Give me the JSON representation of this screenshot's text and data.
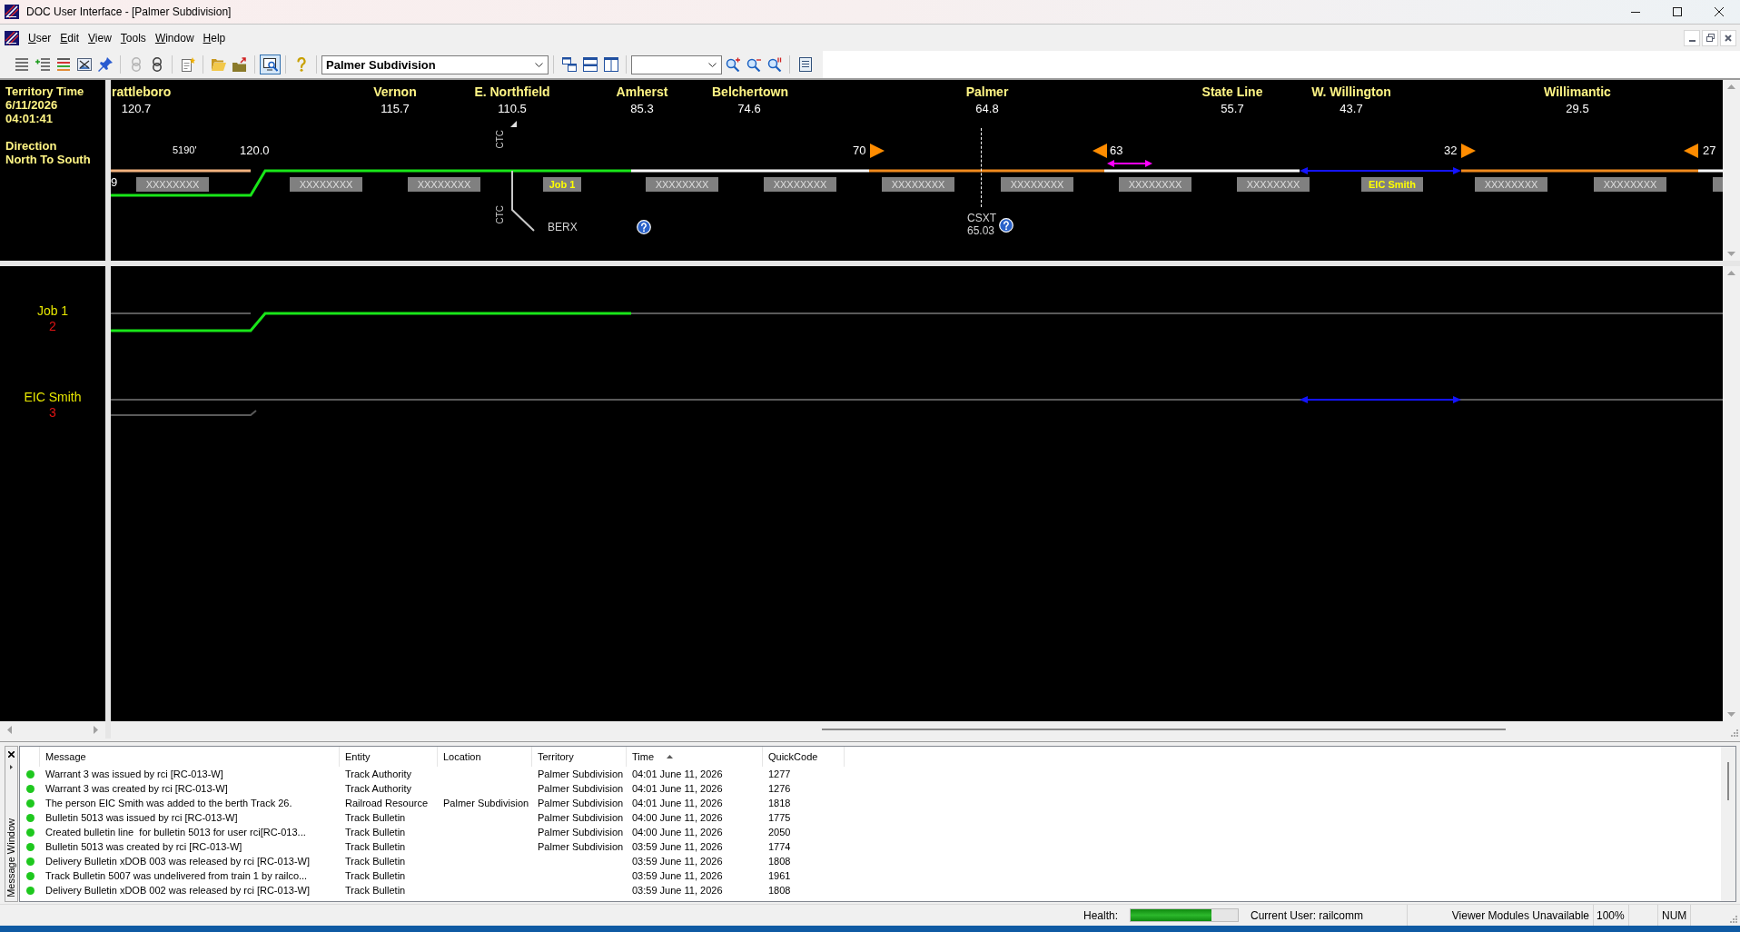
{
  "window": {
    "title": "DOC User Interface - [Palmer Subdivision]"
  },
  "menu": [
    "User",
    "Edit",
    "View",
    "Tools",
    "Window",
    "Help"
  ],
  "toolbar": [
    {
      "kind": "buttons",
      "buttons": [
        {
          "selected": false,
          "disabled": false
        },
        {
          "selected": false,
          "disabled": false
        },
        {
          "selected": false,
          "disabled": false
        },
        {
          "selected": false,
          "disabled": false
        },
        {
          "selected": false,
          "disabled": false
        }
      ]
    },
    {
      "kind": "buttons",
      "buttons": [
        {
          "selected": false,
          "disabled": true
        },
        {
          "selected": false,
          "disabled": false
        }
      ]
    },
    {
      "kind": "buttons",
      "buttons": [
        {
          "selected": false,
          "disabled": false
        }
      ]
    },
    {
      "kind": "buttons",
      "buttons": [
        {
          "selected": false,
          "disabled": false
        },
        {
          "selected": false,
          "disabled": false
        }
      ]
    },
    {
      "kind": "buttons",
      "buttons": [
        {
          "selected": true,
          "disabled": false
        }
      ]
    },
    {
      "kind": "buttons",
      "buttons": [
        {
          "selected": false,
          "disabled": false
        }
      ]
    },
    {
      "kind": "select",
      "value": "Palmer Subdivision"
    },
    {
      "kind": "buttons",
      "buttons": [
        {
          "selected": false,
          "disabled": false
        },
        {
          "selected": false,
          "disabled": false
        },
        {
          "selected": false,
          "disabled": false
        }
      ]
    },
    {
      "kind": "zoom",
      "buttons": [
        {
          "selected": false,
          "disabled": false
        },
        {
          "selected": false,
          "disabled": false
        },
        {
          "selected": false,
          "disabled": false
        }
      ]
    },
    {
      "kind": "buttons",
      "buttons": [
        {
          "selected": false,
          "disabled": false
        }
      ]
    }
  ],
  "territory_info": {
    "time_label": "Territory Time",
    "date": "6/11/2026",
    "time": "04:01:41",
    "direction_label": "Direction",
    "direction": "North To South"
  },
  "territory": {
    "stations": [
      {
        "name": "rattleboro",
        "milepost": "120.7"
      },
      {
        "name": "Vernon",
        "milepost": "115.7"
      },
      {
        "name": "E. Northfield",
        "milepost": "110.5"
      },
      {
        "name": "Amherst",
        "milepost": "85.3"
      },
      {
        "name": "Belchertown",
        "milepost": "74.6"
      },
      {
        "name": "Palmer",
        "milepost": "64.8"
      },
      {
        "name": "State Line",
        "milepost": "55.7"
      },
      {
        "name": "W. Willington",
        "milepost": "43.7"
      },
      {
        "name": "Willimantic",
        "milepost": "29.5"
      }
    ],
    "edge_label": "9",
    "length_label": "5190'",
    "crossover_milepost": "120.0",
    "ctc_labels": [
      "CTC",
      "CTC"
    ],
    "branch_label": "BERX",
    "junction": {
      "railroad": "CSXT",
      "milepost": "65.03"
    },
    "signals": [
      {
        "number": "70",
        "facing_right": true
      },
      {
        "number": "63",
        "facing_right": false
      },
      {
        "number": "32",
        "facing_right": true
      },
      {
        "number": "27",
        "facing_right": false
      }
    ],
    "blocks": [
      {
        "label": "XXXXXXXX",
        "kind": "free"
      },
      {
        "label": "XXXXXXXX",
        "kind": "free"
      },
      {
        "label": "XXXXXXXX",
        "kind": "free"
      },
      {
        "label": "Job 1",
        "kind": "assigned"
      },
      {
        "label": "XXXXXXXX",
        "kind": "free"
      },
      {
        "label": "XXXXXXXX",
        "kind": "free"
      },
      {
        "label": "XXXXXXXX",
        "kind": "free"
      },
      {
        "label": "XXXXXXXX",
        "kind": "free"
      },
      {
        "label": "XXXXXXXX",
        "kind": "free"
      },
      {
        "label": "XXXXXXXX",
        "kind": "free"
      },
      {
        "label": "EIC Smith",
        "kind": "assigned"
      },
      {
        "label": "XXXXXXXX",
        "kind": "free"
      },
      {
        "label": "XXXXXXXX",
        "kind": "free"
      }
    ]
  },
  "authorities": [
    {
      "name": "Job 1",
      "number": "2"
    },
    {
      "name": "EIC Smith",
      "number": "3"
    }
  ],
  "message_window": {
    "title": "Message Window",
    "columns": [
      {
        "label": "Message",
        "sorted": false
      },
      {
        "label": "Entity",
        "sorted": false
      },
      {
        "label": "Location",
        "sorted": false
      },
      {
        "label": "Territory",
        "sorted": false
      },
      {
        "label": "Time",
        "sorted": true
      },
      {
        "label": "QuickCode",
        "sorted": false
      }
    ],
    "rows": [
      {
        "color": "#1ec81e",
        "message": "Warrant 3 was issued by rci [RC-013-W]",
        "entity": "Track Authority",
        "territory": "Palmer Subdivision",
        "time": "04:01 June 11, 2026",
        "quick_code": "1277"
      },
      {
        "color": "#1ec81e",
        "message": "Warrant 3 was created by rci [RC-013-W]",
        "entity": "Track Authority",
        "territory": "Palmer Subdivision",
        "time": "04:01 June 11, 2026",
        "quick_code": "1276"
      },
      {
        "color": "#1ec81e",
        "message": "The person EIC Smith was added to the berth Track 26.",
        "entity": "Railroad Resource",
        "location": "Palmer Subdivision",
        "territory": "Palmer Subdivision",
        "time": "04:01 June 11, 2026",
        "quick_code": "1818"
      },
      {
        "color": "#1ec81e",
        "message": "Bulletin 5013 was issued by rci [RC-013-W]",
        "entity": "Track Bulletin",
        "territory": "Palmer Subdivision",
        "time": "04:00 June 11, 2026",
        "quick_code": "1775"
      },
      {
        "color": "#1ec81e",
        "message": "Created bulletin line  for bulletin 5013 for user rci[RC-013...",
        "entity": "Track Bulletin",
        "territory": "Palmer Subdivision",
        "time": "04:00 June 11, 2026",
        "quick_code": "2050"
      },
      {
        "color": "#1ec81e",
        "message": "Bulletin 5013 was created by rci [RC-013-W]",
        "entity": "Track Bulletin",
        "territory": "Palmer Subdivision",
        "time": "03:59 June 11, 2026",
        "quick_code": "1774"
      },
      {
        "color": "#1ec81e",
        "message": "Delivery Bulletin xDOB 003 was released by rci [RC-013-W]",
        "entity": "Track Bulletin",
        "time": "03:59 June 11, 2026",
        "quick_code": "1808"
      },
      {
        "color": "#1ec81e",
        "message": "Track Bulletin 5007 was undelivered from train 1 by railco...",
        "entity": "Track Bulletin",
        "time": "03:59 June 11, 2026",
        "quick_code": "1961"
      },
      {
        "color": "#1ec81e",
        "message": "Delivery Bulletin xDOB 002 was released by rci [RC-013-W]",
        "entity": "Track Bulletin",
        "time": "03:59 June 11, 2026",
        "quick_code": "1808"
      }
    ]
  },
  "status_bar": {
    "health_label": "Health:",
    "health": {
      "level": 0.75
    },
    "current_user": "Current User: railcomm",
    "modules": "Viewer Modules Unavailable",
    "zoom": "100%",
    "keyboard": "NUM"
  }
}
